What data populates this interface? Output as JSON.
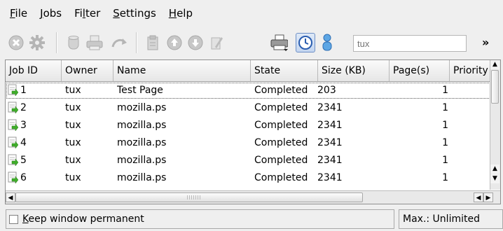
{
  "menu": [
    {
      "prefix": "",
      "mnemonic": "F",
      "suffix": "ile"
    },
    {
      "prefix": "",
      "mnemonic": "J",
      "suffix": "obs"
    },
    {
      "prefix": "Fi",
      "mnemonic": "l",
      "suffix": "ter"
    },
    {
      "prefix": "",
      "mnemonic": "S",
      "suffix": "ettings"
    },
    {
      "prefix": "",
      "mnemonic": "H",
      "suffix": "elp"
    }
  ],
  "toolbar": {
    "user_filter_placeholder": "tux",
    "overflow": "»",
    "icons": [
      "cancel-job-icon",
      "settings-icon",
      "hold-job-icon",
      "print-job-icon",
      "redirect-job-icon",
      "clipboard-icon",
      "move-up-icon",
      "move-down-icon",
      "edit-icon",
      "printer-icon",
      "timer-icon",
      "user-icon"
    ]
  },
  "table": {
    "columns": [
      "Job ID",
      "Owner",
      "Name",
      "State",
      "Size (KB)",
      "Page(s)",
      "Priority"
    ],
    "rows": [
      {
        "id": "1",
        "owner": "tux",
        "name": "Test Page",
        "state": "Completed",
        "size": "203",
        "pages": "1"
      },
      {
        "id": "2",
        "owner": "tux",
        "name": "mozilla.ps",
        "state": "Completed",
        "size": "2341",
        "pages": "1"
      },
      {
        "id": "3",
        "owner": "tux",
        "name": "mozilla.ps",
        "state": "Completed",
        "size": "2341",
        "pages": "1"
      },
      {
        "id": "4",
        "owner": "tux",
        "name": "mozilla.ps",
        "state": "Completed",
        "size": "2341",
        "pages": "1"
      },
      {
        "id": "5",
        "owner": "tux",
        "name": "mozilla.ps",
        "state": "Completed",
        "size": "2341",
        "pages": "1"
      },
      {
        "id": "6",
        "owner": "tux",
        "name": "mozilla.ps",
        "state": "Completed",
        "size": "2341",
        "pages": "1"
      }
    ]
  },
  "status": {
    "keep_prefix": "",
    "keep_mnemonic": "K",
    "keep_suffix": "eep window permanent",
    "max_label": "Max.: Unlimited"
  }
}
